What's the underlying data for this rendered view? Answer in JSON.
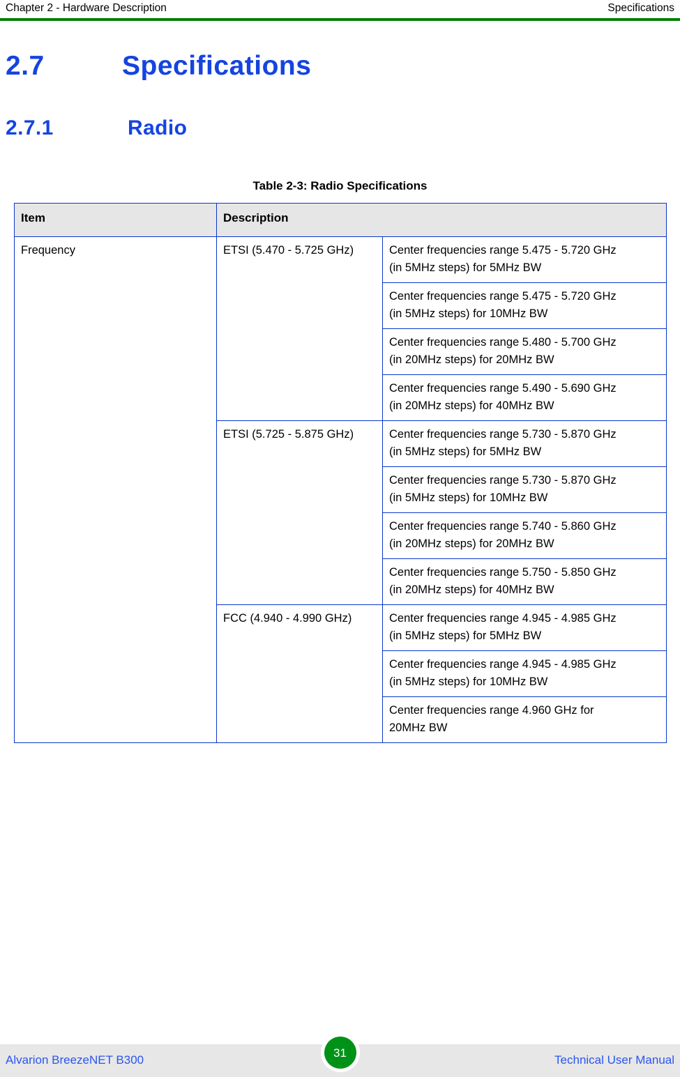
{
  "header": {
    "left": "Chapter 2 - Hardware Description",
    "right": "Specifications",
    "rule_color": "#008000"
  },
  "headings": {
    "h1_number": "2.7",
    "h1_title": "Specifications",
    "h2_number": "2.7.1",
    "h2_title": "Radio",
    "color": "#1544e0"
  },
  "table": {
    "caption": "Table 2-3: Radio Specifications",
    "border_color": "#0a36c8",
    "header_background": "#e6e6e6",
    "columns": [
      {
        "key": "item",
        "label": "Item"
      },
      {
        "key": "description",
        "label": "Description"
      }
    ],
    "item_label": "Frequency",
    "groups": [
      {
        "band": "ETSI (5.470 - 5.725 GHz)",
        "rows": [
          {
            "line1": "Center frequencies range 5.475 - 5.720 GHz",
            "line2": "(in 5MHz steps) for 5MHz BW"
          },
          {
            "line1": "Center frequencies range 5.475 - 5.720 GHz",
            "line2": "(in 5MHz steps) for 10MHz BW"
          },
          {
            "line1": "Center frequencies range 5.480 - 5.700 GHz",
            "line2": "(in 20MHz steps) for 20MHz BW"
          },
          {
            "line1": "Center frequencies range 5.490 - 5.690 GHz",
            "line2": "(in 20MHz steps) for 40MHz BW"
          }
        ]
      },
      {
        "band": "ETSI (5.725 - 5.875 GHz)",
        "rows": [
          {
            "line1": "Center frequencies range 5.730 - 5.870 GHz",
            "line2": "(in 5MHz steps) for 5MHz BW"
          },
          {
            "line1": "Center frequencies range 5.730 - 5.870 GHz",
            "line2": "(in 5MHz steps) for 10MHz BW"
          },
          {
            "line1": "Center frequencies range 5.740 - 5.860 GHz",
            "line2": "(in 20MHz steps) for 20MHz BW"
          },
          {
            "line1": "Center frequencies range 5.750 - 5.850 GHz",
            "line2": "(in 20MHz steps) for 40MHz BW"
          }
        ]
      },
      {
        "band": "FCC (4.940 - 4.990 GHz)",
        "rows": [
          {
            "line1": "Center frequencies range 4.945 - 4.985 GHz",
            "line2": "(in 5MHz steps) for 5MHz BW"
          },
          {
            "line1": "Center frequencies range 4.945 - 4.985 GHz",
            "line2": "(in 5MHz steps) for 10MHz BW"
          },
          {
            "line1": "Center frequencies range 4.960 GHz for",
            "line2": "20MHz BW"
          }
        ]
      }
    ]
  },
  "footer": {
    "left": "Alvarion BreezeNET B300",
    "right": "Technical User Manual",
    "page_number": "31",
    "badge_color": "#009217",
    "text_color": "#2a56f0"
  }
}
